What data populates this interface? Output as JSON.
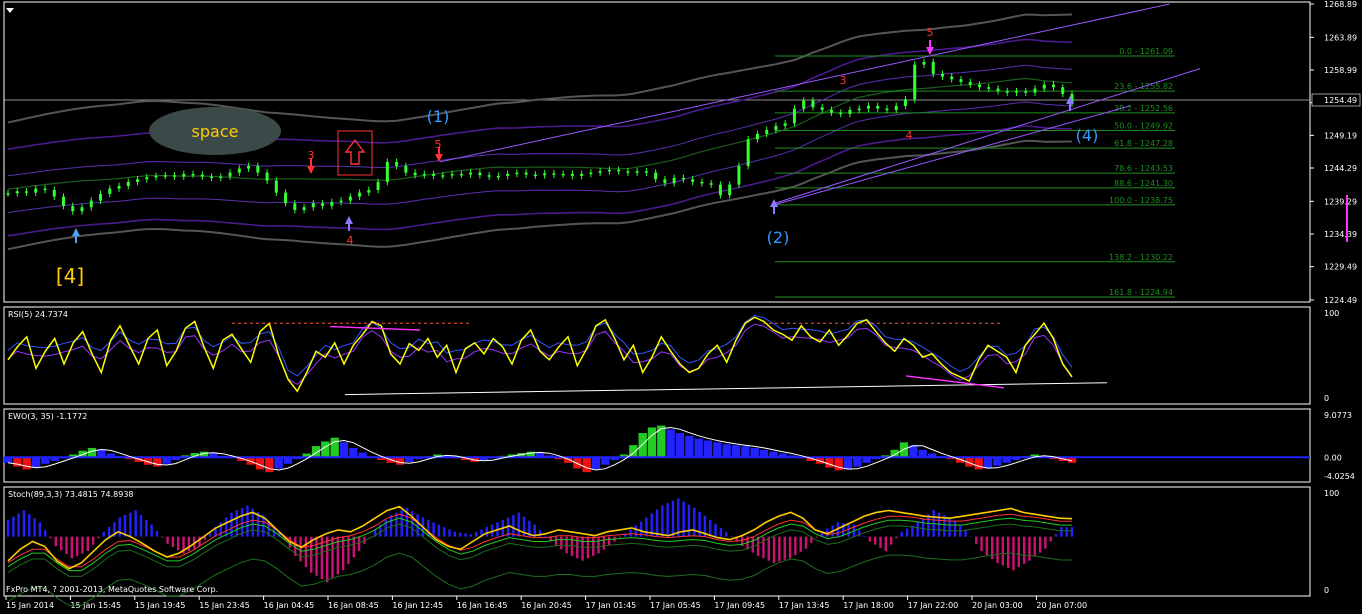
{
  "footer": {
    "copyright": "FxPro MT4, ? 2001-2013, MetaQuotes Software Corp."
  },
  "colors": {
    "background": "#000000",
    "grid_line": "#ffffff",
    "candle": "#33ff33",
    "rsi": "#ffff00",
    "channel": "#9b59ff",
    "envelope_dark": "#4b1a8c",
    "fib": "#1f8f1f",
    "label_blue": "#3399ff",
    "label_red": "#ff3333",
    "label_yellow": "#ffcc00",
    "magenta": "#ff33ff",
    "ewo_green": "#22cc22",
    "ewo_blue": "#2222ff",
    "ewo_red": "#ee1111",
    "stoch_blue": "#2222ff",
    "stoch_magenta": "#cc1177",
    "stoch_main": "#ffcc00",
    "stoch_signal": "#ff3333"
  },
  "chart_data": [
    {
      "type": "line",
      "symbol_panel": "price",
      "y_ticks": [
        "1268.89",
        "1263.89",
        "1258.99",
        "1254.09",
        "1249.19",
        "1244.29",
        "1239.29",
        "1234.39",
        "1229.49",
        "1224.49"
      ],
      "ylim": [
        1224.49,
        1268.89
      ],
      "current_price": "1254.49",
      "x_ticks": [
        "15 Jan 2014",
        "15 Jan 15:45",
        "15 Jan 19:45",
        "15 Jan 23:45",
        "16 Jan 04:45",
        "16 Jan 08:45",
        "16 Jan 12:45",
        "16 Jan 16:45",
        "16 Jan 20:45",
        "17 Jan 01:45",
        "17 Jan 05:45",
        "17 Jan 09:45",
        "17 Jan 13:45",
        "17 Jan 18:00",
        "17 Jan 22:00",
        "20 Jan 03:00",
        "20 Jan 07:00"
      ],
      "fib_levels": [
        {
          "label": "0.0 - 1261.09",
          "value": 1261.09
        },
        {
          "label": "23.6 - 1255.82",
          "value": 1255.82
        },
        {
          "label": "38.2 - 1252.56",
          "value": 1252.56
        },
        {
          "label": "50.0 - 1249.92",
          "value": 1249.92
        },
        {
          "label": "61.8 - 1247.28",
          "value": 1247.28
        },
        {
          "label": "78.6 - 1243.53",
          "value": 1243.53
        },
        {
          "label": "88.6 - 1241.30",
          "value": 1241.3
        },
        {
          "label": "100.0 - 1238.75",
          "value": 1238.75
        },
        {
          "label": "138.2 - 1230.22",
          "value": 1230.22
        },
        {
          "label": "161.8 - 1224.94",
          "value": 1224.94
        }
      ],
      "wave_labels": [
        "[4]",
        "(1)",
        "(2)",
        "(4)",
        "3",
        "4",
        "5",
        "3",
        "4",
        "5"
      ],
      "annotation": "space",
      "price_series": [
        1240.5,
        1240.8,
        1240.6,
        1241.2,
        1241.0,
        1240.0,
        1238.6,
        1237.8,
        1238.4,
        1239.4,
        1240.4,
        1241.2,
        1241.6,
        1242.2,
        1242.6,
        1242.9,
        1243.1,
        1243.2,
        1243.0,
        1243.4,
        1243.3,
        1243.0,
        1242.8,
        1243.0,
        1243.6,
        1244.2,
        1244.6,
        1243.6,
        1242.4,
        1240.6,
        1239.0,
        1238.0,
        1238.4,
        1239.0,
        1238.6,
        1239.2,
        1239.4,
        1240.0,
        1240.6,
        1241.0,
        1242.2,
        1245.2,
        1244.6,
        1243.6,
        1243.2,
        1243.4,
        1243.1,
        1243.2,
        1243.4,
        1243.3,
        1243.6,
        1243.2,
        1243.0,
        1243.1,
        1243.4,
        1243.6,
        1243.3,
        1243.2,
        1243.5,
        1243.3,
        1243.4,
        1243.1,
        1243.4,
        1243.6,
        1243.8,
        1244.0,
        1243.8,
        1243.6,
        1243.8,
        1243.6,
        1242.6,
        1242.0,
        1242.8,
        1242.6,
        1242.2,
        1242.0,
        1241.8,
        1240.2,
        1241.8,
        1244.6,
        1248.6,
        1249.4,
        1250.0,
        1250.6,
        1251.0,
        1253.2,
        1254.4,
        1253.4,
        1253.0,
        1252.6,
        1252.4,
        1253.0,
        1253.2,
        1253.6,
        1253.2,
        1253.0,
        1253.6,
        1254.6,
        1259.8,
        1260.2,
        1258.4,
        1258.0,
        1257.6,
        1257.2,
        1256.8,
        1256.4,
        1256.2,
        1255.8,
        1255.6,
        1255.8,
        1255.6,
        1256.2,
        1256.8,
        1256.4,
        1255.4,
        1254.0
      ]
    },
    {
      "type": "line",
      "panel": "RSI",
      "label": "RSI(5) 24.7374",
      "y_ticks": [
        "100",
        "0"
      ],
      "ylim": [
        0,
        100
      ],
      "values": [
        45,
        60,
        72,
        35,
        55,
        70,
        40,
        65,
        78,
        52,
        30,
        68,
        85,
        62,
        40,
        70,
        80,
        38,
        55,
        82,
        90,
        60,
        35,
        68,
        75,
        58,
        42,
        78,
        88,
        50,
        22,
        8,
        30,
        55,
        48,
        65,
        40,
        62,
        75,
        90,
        85,
        52,
        40,
        64,
        56,
        70,
        48,
        62,
        30,
        58,
        65,
        52,
        70,
        60,
        40,
        68,
        80,
        55,
        45,
        60,
        72,
        38,
        58,
        85,
        92,
        70,
        45,
        62,
        30,
        48,
        72,
        55,
        40,
        30,
        35,
        52,
        62,
        42,
        68,
        88,
        95,
        90,
        80,
        75,
        68,
        85,
        72,
        66,
        80,
        62,
        74,
        88,
        92,
        78,
        65,
        55,
        70,
        62,
        48,
        52,
        40,
        30,
        25,
        20,
        45,
        62,
        55,
        48,
        30,
        62,
        75,
        88,
        70,
        40,
        24.7374
      ],
      "trendline": "up"
    },
    {
      "type": "bar",
      "panel": "EWO",
      "label": "EWO(3, 35) -1.1772",
      "y_ticks": [
        "9.0773",
        "0.00",
        "-4.0254"
      ],
      "ylim": [
        -4.0254,
        9.0773
      ],
      "values": [
        -1.2,
        -2.0,
        -2.6,
        -2.2,
        -1.4,
        -0.8,
        -0.2,
        0.6,
        1.4,
        2.0,
        1.6,
        0.8,
        0.2,
        -0.4,
        -1.0,
        -1.6,
        -2.0,
        -1.4,
        -0.6,
        0.4,
        0.9,
        1.2,
        0.8,
        0.3,
        -0.2,
        -0.8,
        -1.6,
        -2.6,
        -3.2,
        -2.4,
        -1.4,
        -0.4,
        0.8,
        2.4,
        3.4,
        4.2,
        3.2,
        2.0,
        1.0,
        0.2,
        -0.6,
        -1.2,
        -1.6,
        -1.0,
        -0.4,
        0.2,
        0.6,
        0.4,
        -0.2,
        -0.6,
        -1.0,
        -0.6,
        -0.2,
        0.3,
        0.6,
        0.9,
        1.2,
        1.0,
        0.4,
        -0.4,
        -1.2,
        -2.4,
        -3.2,
        -2.6,
        -1.6,
        -0.6,
        0.6,
        2.6,
        5.2,
        6.4,
        6.8,
        6.0,
        5.2,
        4.6,
        4.0,
        3.6,
        3.2,
        2.8,
        2.6,
        2.4,
        2.0,
        1.6,
        1.2,
        0.8,
        0.4,
        -0.2,
        -0.8,
        -1.4,
        -2.2,
        -2.8,
        -2.6,
        -2.0,
        -1.2,
        -0.4,
        0.4,
        1.6,
        3.2,
        2.6,
        1.6,
        0.8,
        0.2,
        -0.4,
        -1.2,
        -2.0,
        -2.6,
        -2.4,
        -1.8,
        -1.2,
        -0.6,
        0.2,
        0.6,
        0.2,
        -0.4,
        -0.8,
        -1.1772
      ]
    },
    {
      "type": "bar",
      "panel": "Stoch",
      "label": "Stoch(89,3,3) 73.4815 74.8938",
      "y_ticks": [
        "100",
        "0"
      ],
      "ylim": [
        0,
        100
      ],
      "main": [
        30,
        42,
        50,
        45,
        30,
        22,
        28,
        40,
        52,
        60,
        55,
        48,
        40,
        34,
        38,
        46,
        55,
        64,
        70,
        76,
        80,
        74,
        62,
        50,
        44,
        52,
        58,
        62,
        60,
        66,
        74,
        82,
        86,
        76,
        64,
        52,
        45,
        42,
        50,
        58,
        62,
        66,
        60,
        56,
        58,
        62,
        60,
        58,
        56,
        60,
        62,
        64,
        60,
        58,
        56,
        60,
        62,
        58,
        54,
        52,
        56,
        62,
        70,
        76,
        80,
        74,
        62,
        58,
        64,
        70,
        76,
        80,
        82,
        80,
        78,
        76,
        75,
        74,
        76,
        78,
        80,
        82,
        84,
        80,
        78,
        76,
        74,
        73.4815
      ],
      "signal": [
        32,
        40,
        46,
        46,
        36,
        28,
        28,
        36,
        46,
        54,
        55,
        50,
        44,
        38,
        38,
        44,
        52,
        60,
        66,
        72,
        76,
        74,
        66,
        56,
        48,
        50,
        54,
        58,
        60,
        64,
        70,
        78,
        82,
        78,
        68,
        58,
        50,
        45,
        48,
        54,
        58,
        62,
        60,
        58,
        58,
        60,
        60,
        58,
        58,
        60,
        61,
        62,
        61,
        59,
        58,
        59,
        60,
        59,
        56,
        54,
        55,
        59,
        66,
        72,
        76,
        74,
        66,
        61,
        63,
        68,
        73,
        77,
        80,
        80,
        79,
        77,
        76,
        75,
        75,
        77,
        79,
        81,
        82,
        80,
        79,
        77,
        75,
        74.8938
      ],
      "histogram": [
        0.35,
        0.55,
        0.3,
        -0.2,
        -0.45,
        -0.3,
        0.1,
        0.4,
        0.55,
        0.25,
        -0.15,
        -0.35,
        -0.2,
        0.2,
        0.5,
        0.65,
        0.45,
        0.1,
        -0.4,
        -0.75,
        -0.95,
        -0.7,
        -0.3,
        0.15,
        0.45,
        0.6,
        0.4,
        0.25,
        0.1,
        0.05,
        0.2,
        0.35,
        0.5,
        0.25,
        -0.1,
        -0.35,
        -0.5,
        -0.35,
        -0.1,
        0.15,
        0.4,
        0.65,
        0.8,
        0.6,
        0.35,
        0.1,
        -0.2,
        -0.4,
        -0.55,
        -0.45,
        -0.25,
        0.1,
        0.3,
        0.25,
        -0.1,
        -0.3,
        0.1,
        0.3,
        0.55,
        0.4,
        0.15,
        -0.3,
        -0.55,
        -0.7,
        -0.5,
        -0.25,
        0.2
      ]
    }
  ]
}
